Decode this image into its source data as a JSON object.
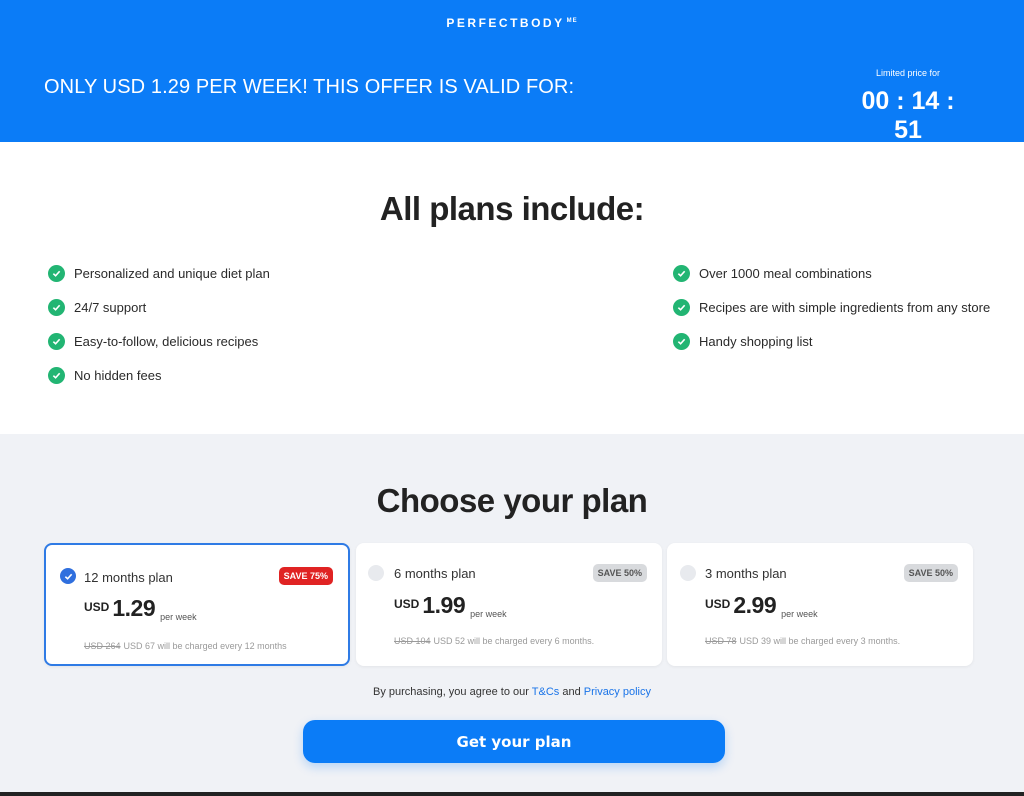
{
  "header": {
    "logo": "PERFECTBODY",
    "logo_sup": "ME",
    "offer": "ONLY USD 1.29 PER WEEK! THIS OFFER IS VALID FOR:",
    "timer_caption": "Limited price for",
    "timer": "00 : 14 : 51",
    "bg_color": "#0b7cf7"
  },
  "features": {
    "title": "All plans include:",
    "left": [
      "Personalized and unique diet plan",
      "24/7 support",
      "Easy-to-follow, delicious recipes",
      "No hidden fees"
    ],
    "right": [
      "Over 1000 meal combinations",
      "Recipes are with simple ingredients from any store",
      "Handy shopping list"
    ],
    "check_color": "#22b573"
  },
  "plans": {
    "title": "Choose your plan",
    "items": [
      {
        "name": "12 months plan",
        "badge": "SAVE 75%",
        "currency": "USD",
        "amount": "1.29",
        "per": "per week",
        "old_price": "USD 264",
        "billing": "USD 67 will be charged every 12 months",
        "selected": true
      },
      {
        "name": "6 months plan",
        "badge": "SAVE 50%",
        "currency": "USD",
        "amount": "1.99",
        "per": "per week",
        "old_price": "USD 104",
        "billing": "USD 52 will be charged every 6 months.",
        "selected": false
      },
      {
        "name": "3 months plan",
        "badge": "SAVE 50%",
        "currency": "USD",
        "amount": "2.99",
        "per": "per week",
        "old_price": "USD 78",
        "billing": "USD 39 will be charged every 3 months.",
        "selected": false
      }
    ],
    "accent": "#2f7be5",
    "hot_badge_color": "#e02323"
  },
  "terms": {
    "prefix": "By purchasing, you agree to our ",
    "tcs": "T&Cs",
    "and": " and ",
    "privacy": "Privacy policy"
  },
  "cta": {
    "label": "Get your plan"
  }
}
